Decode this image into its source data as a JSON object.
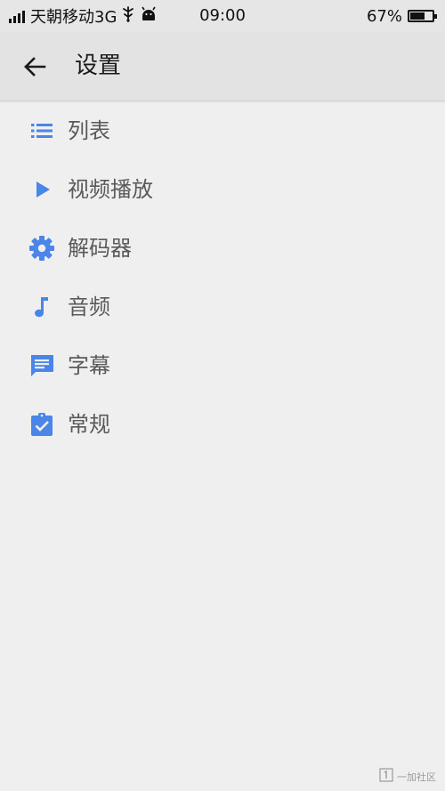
{
  "status_bar": {
    "carrier": "天朝移动3G",
    "time": "09:00",
    "battery_percent": "67%",
    "battery_level": 0.67,
    "icons": [
      "signal-icon",
      "usb-icon",
      "android-icon",
      "battery-icon"
    ]
  },
  "app_bar": {
    "title": "设置",
    "back_icon": "arrow-left-icon"
  },
  "menu": {
    "items": [
      {
        "label": "列表",
        "icon": "list-icon"
      },
      {
        "label": "视频播放",
        "icon": "play-icon"
      },
      {
        "label": "解码器",
        "icon": "gear-icon"
      },
      {
        "label": "音频",
        "icon": "music-note-icon"
      },
      {
        "label": "字幕",
        "icon": "subtitle-icon"
      },
      {
        "label": "常规",
        "icon": "clipboard-check-icon"
      }
    ]
  },
  "watermark": {
    "logo": "oneplus-logo",
    "text": "一加社区"
  },
  "colors": {
    "accent": "#4a86e8",
    "background": "#efefef",
    "app_bar": "#e3e3e3",
    "label_text": "#5a5a5a"
  }
}
